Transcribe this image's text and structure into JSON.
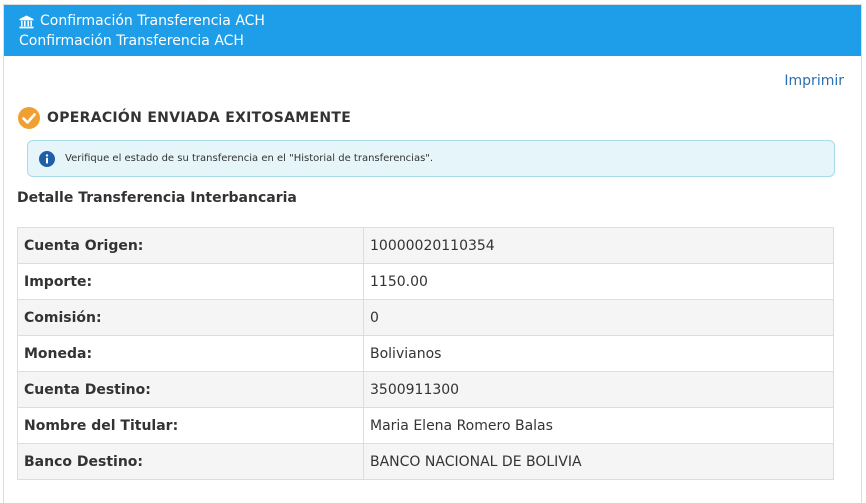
{
  "header": {
    "title": "Confirmación Transferencia ACH",
    "subtitle": "Confirmación Transferencia ACH"
  },
  "actions": {
    "print_label": "Imprimir"
  },
  "status": {
    "message": "OPERACIÓN ENVIADA EXITOSAMENTE"
  },
  "info": {
    "message": "Verifique el estado de su transferencia en el \"Historial de transferencias\"."
  },
  "detail": {
    "title": "Detalle Transferencia Interbancaria",
    "rows": [
      {
        "label": "Cuenta Origen:",
        "value": "10000020110354"
      },
      {
        "label": "Importe:",
        "value": "1150.00"
      },
      {
        "label": "Comisión:",
        "value": "0"
      },
      {
        "label": "Moneda:",
        "value": "Bolivianos"
      },
      {
        "label": "Cuenta Destino:",
        "value": "3500911300"
      },
      {
        "label": "Nombre del Titular:",
        "value": "Maria Elena Romero Balas"
      },
      {
        "label": "Banco Destino:",
        "value": "BANCO NACIONAL DE BOLIVIA"
      }
    ]
  },
  "colors": {
    "header_bg": "#1e9de8",
    "success_icon": "#f0a030",
    "info_icon": "#1f5fa8",
    "link": "#2a6fb0"
  },
  "icons": {
    "header": "bank-icon",
    "status": "check-circle-icon",
    "info": "info-icon"
  }
}
